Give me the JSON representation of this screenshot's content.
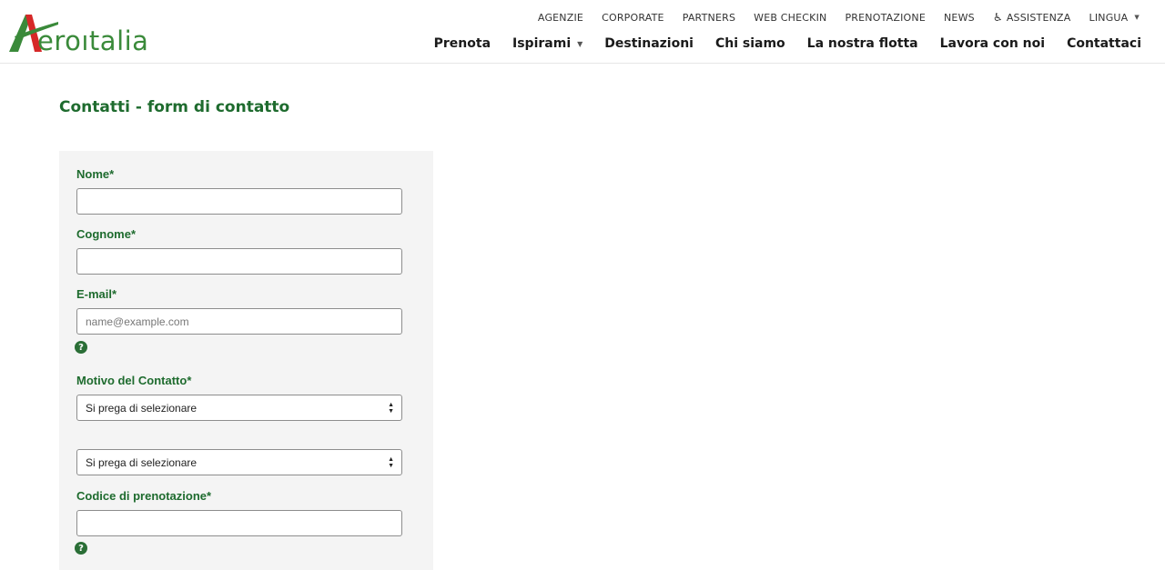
{
  "logo": {
    "text": "eroıtalia",
    "brand_green": "#3a8a3a",
    "brand_red": "#d62828"
  },
  "top_nav": [
    {
      "label": "AGENZIE"
    },
    {
      "label": "CORPORATE"
    },
    {
      "label": "PARTNERS"
    },
    {
      "label": "WEB CHECKIN"
    },
    {
      "label": "PRENOTAZIONE"
    },
    {
      "label": "NEWS"
    },
    {
      "label": "ASSISTENZA",
      "icon": "accessibility-icon"
    },
    {
      "label": "LINGUA",
      "icon": "caret-down-icon"
    }
  ],
  "main_nav": [
    {
      "label": "Prenota"
    },
    {
      "label": "Ispirami",
      "icon": "caret-down-icon"
    },
    {
      "label": "Destinazioni"
    },
    {
      "label": "Chi siamo"
    },
    {
      "label": "La nostra flotta"
    },
    {
      "label": "Lavora con noi"
    },
    {
      "label": "Contattaci"
    }
  ],
  "page": {
    "title": "Contatti - form di contatto"
  },
  "form": {
    "nome": {
      "label": "Nome*",
      "value": ""
    },
    "cognome": {
      "label": "Cognome*",
      "value": ""
    },
    "email": {
      "label": "E-mail*",
      "value": "",
      "placeholder": "name@example.com",
      "help_icon": "question-circle-icon"
    },
    "motivo": {
      "label": "Motivo del Contatto*",
      "selected": "Si prega di selezionare"
    },
    "sub_motivo": {
      "selected": "Si prega di selezionare"
    },
    "codice": {
      "label": "Codice di prenotazione*",
      "value": "",
      "help_icon": "question-circle-icon"
    }
  },
  "colors": {
    "label_green": "#1e6b2e",
    "panel_bg": "#f4f4f4",
    "help_icon_bg": "#2a6e36"
  }
}
